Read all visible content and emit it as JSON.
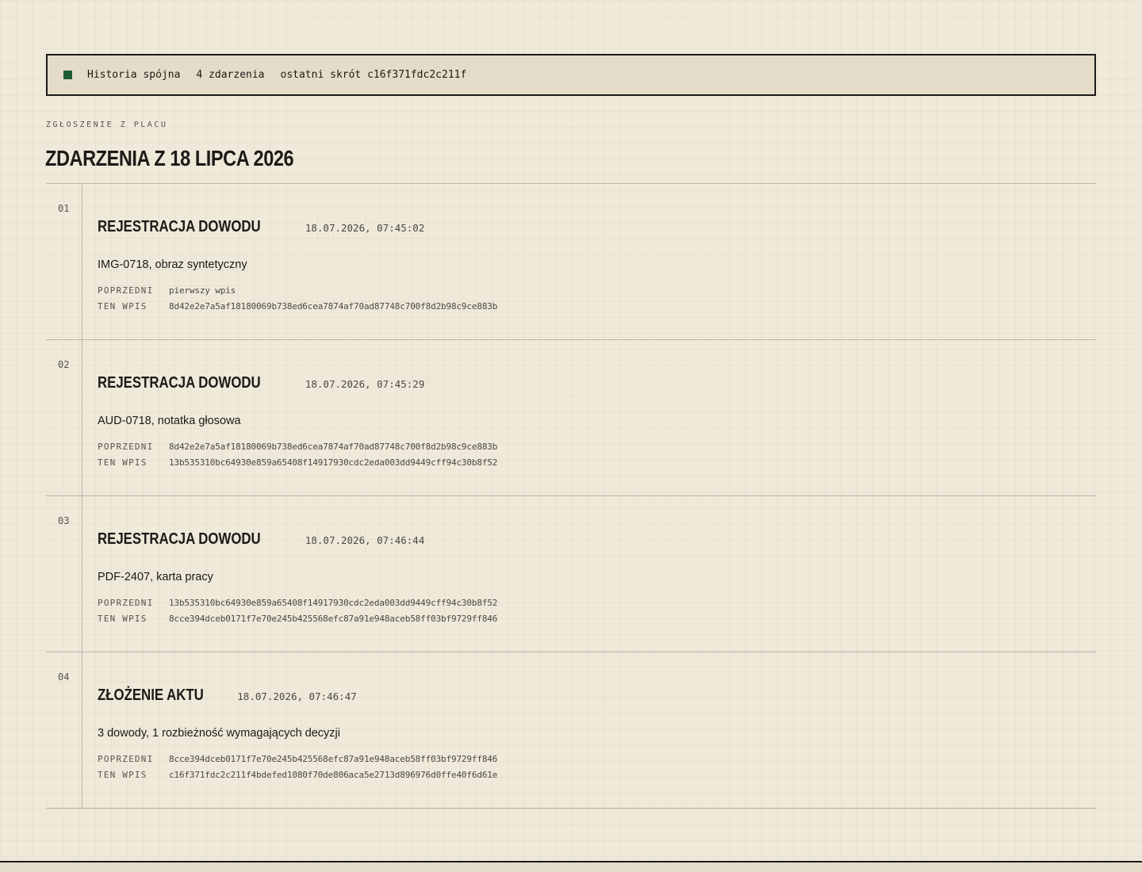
{
  "status": {
    "state": "Historia spójna",
    "count": "4 zdarzenia",
    "last_hash": "ostatni skrót c16f371fdc2c211f",
    "indicator_color": "#1e5c36"
  },
  "header": {
    "eyebrow": "ZGŁOSZENIE Z PLACU",
    "title": "ZDARZENIA Z 18 LIPCA 2026"
  },
  "labels": {
    "previous": "POPRZEDNI",
    "current": "TEN WPIS"
  },
  "events": [
    {
      "index": "01",
      "type": "REJESTRACJA DOWODU",
      "time": "18.07.2026, 07:45:02",
      "description": "IMG-0718, obraz syntetyczny",
      "previous": "pierwszy wpis",
      "current": "8d42e2e7a5af18180069b738ed6cea7874af70ad87748c700f8d2b98c9ce883b"
    },
    {
      "index": "02",
      "type": "REJESTRACJA DOWODU",
      "time": "18.07.2026, 07:45:29",
      "description": "AUD-0718, notatka głosowa",
      "previous": "8d42e2e7a5af18180069b738ed6cea7874af70ad87748c700f8d2b98c9ce883b",
      "current": "13b535310bc64930e859a65408f14917930cdc2eda003dd9449cff94c30b8f52"
    },
    {
      "index": "03",
      "type": "REJESTRACJA DOWODU",
      "time": "18.07.2026, 07:46:44",
      "description": "PDF-2407, karta pracy",
      "previous": "13b535310bc64930e859a65408f14917930cdc2eda003dd9449cff94c30b8f52",
      "current": "8cce394dceb0171f7e70e245b425568efc87a91e948aceb58ff03bf9729ff846"
    },
    {
      "index": "04",
      "type": "ZŁOŻENIE AKTU",
      "time": "18.07.2026, 07:46:47",
      "description": "3 dowody, 1 rozbieżność wymagających decyzji",
      "previous": "8cce394dceb0171f7e70e245b425568efc87a91e948aceb58ff03bf9729ff846",
      "current": "c16f371fdc2c211f4bdefed1080f70de806aca5e2713d896976d0ffe40f6d61e"
    }
  ]
}
